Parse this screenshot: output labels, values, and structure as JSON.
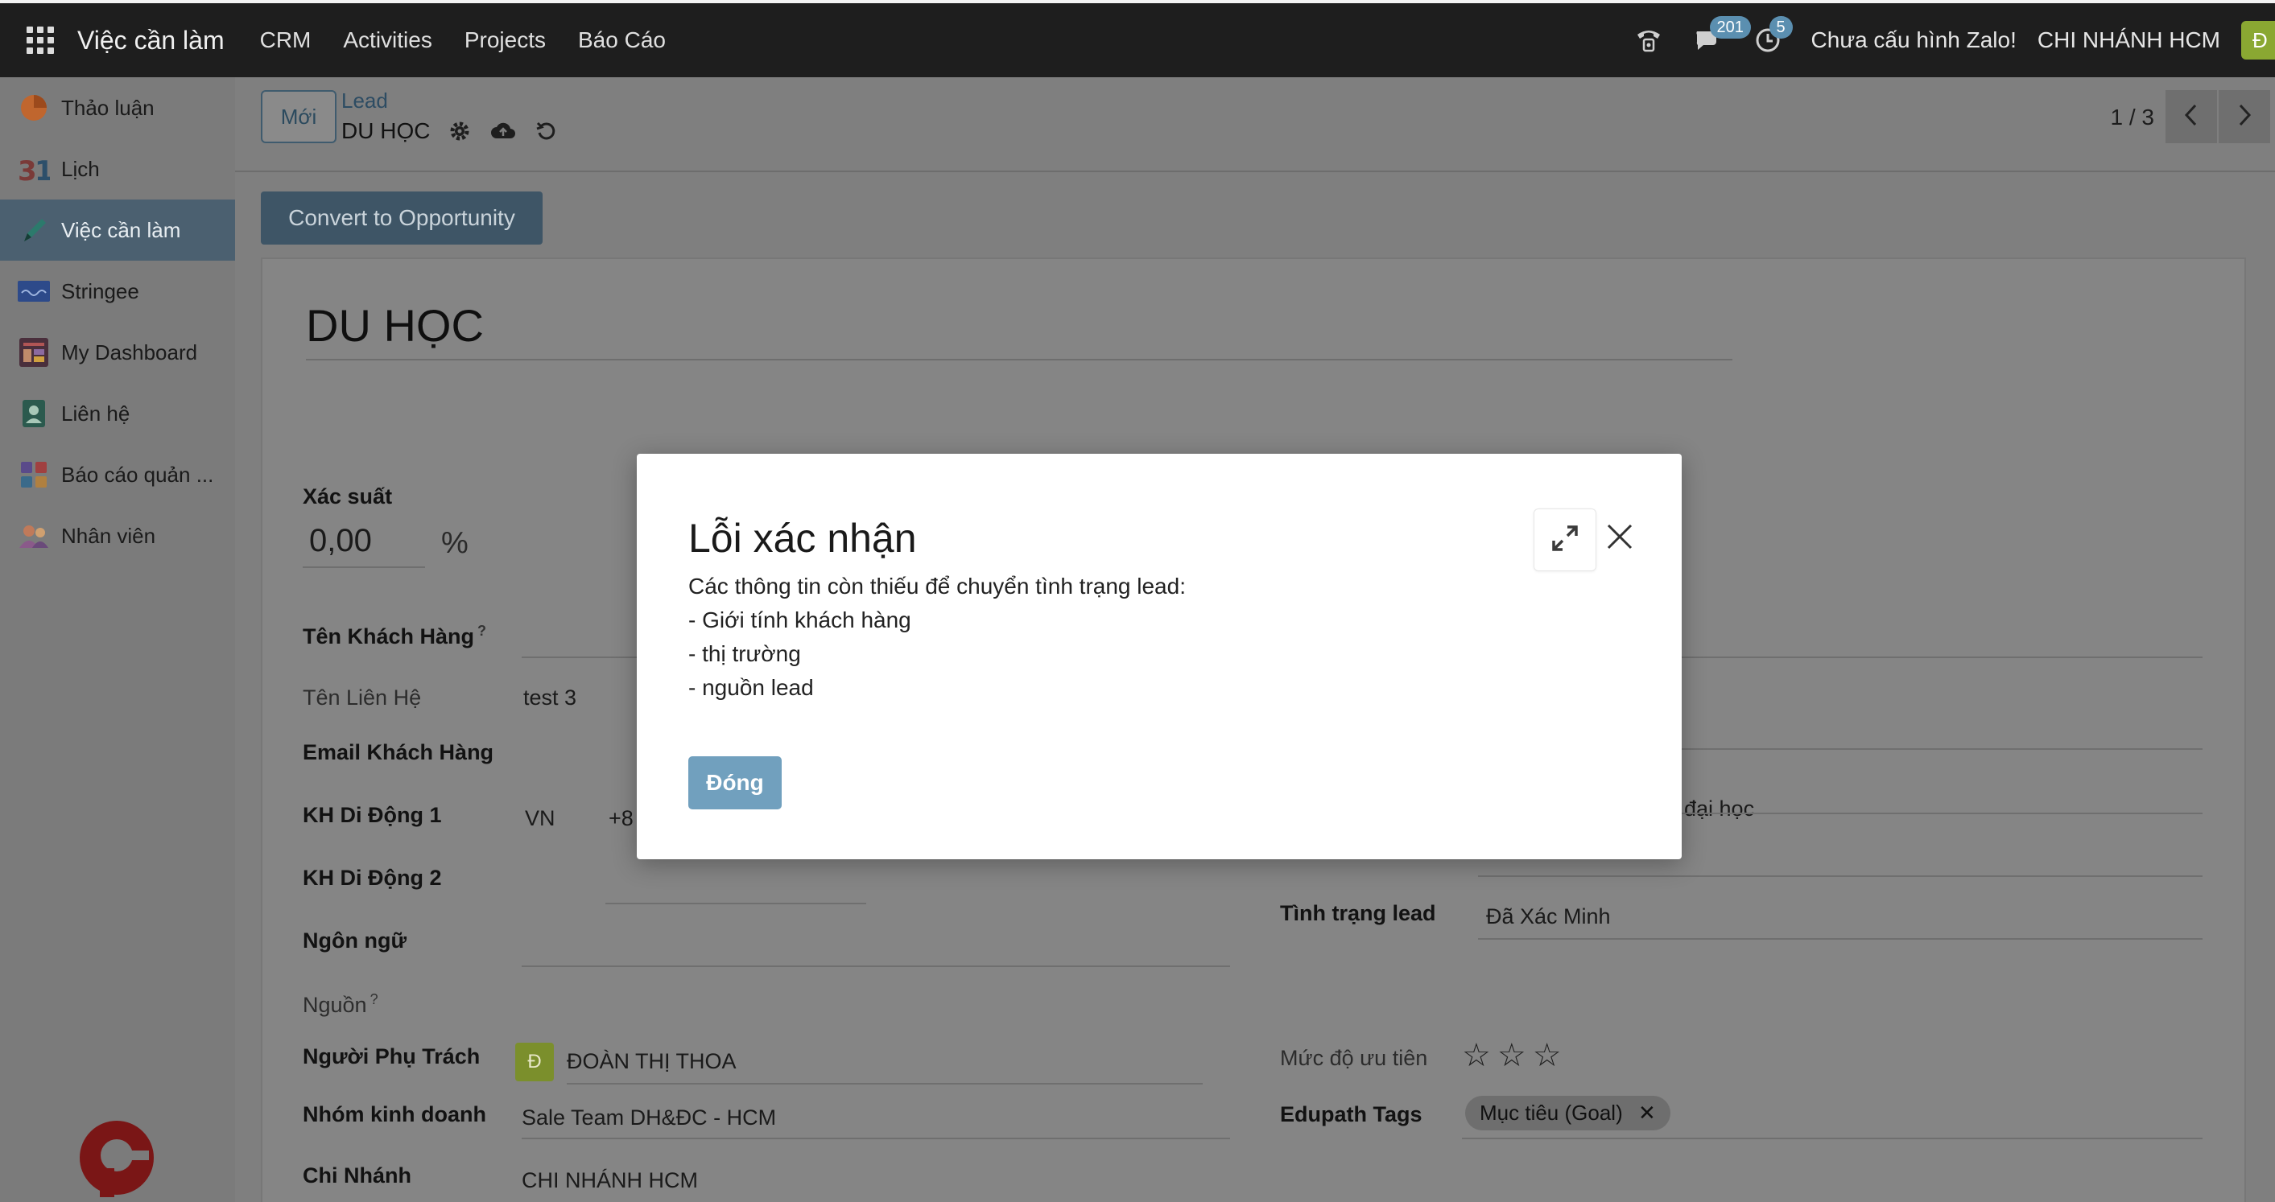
{
  "topbar": {
    "app_name": "Việc cần làm",
    "menu": [
      "CRM",
      "Activities",
      "Projects",
      "Báo Cáo"
    ],
    "messages_count": "201",
    "activities_count": "5",
    "zalo_status": "Chưa cấu hình Zalo!",
    "company": "CHI NHÁNH HCM",
    "user_initial": "Đ"
  },
  "sidebar": {
    "items": [
      {
        "label": "Thảo luận",
        "icon": "discuss-icon"
      },
      {
        "label": "Lịch",
        "icon": "calendar-icon"
      },
      {
        "label": "Việc cần làm",
        "icon": "todo-icon"
      },
      {
        "label": "Stringee",
        "icon": "stringee-icon"
      },
      {
        "label": "My Dashboard",
        "icon": "dashboard-icon"
      },
      {
        "label": "Liên hệ",
        "icon": "contacts-icon"
      },
      {
        "label": "Báo cáo quản ...",
        "icon": "reports-icon"
      },
      {
        "label": "Nhân viên",
        "icon": "employees-icon"
      }
    ],
    "active_index": 2
  },
  "control_panel": {
    "new_button": "Mới",
    "breadcrumb_parent": "Lead",
    "breadcrumb_current": "DU HỌC",
    "pager": "1 / 3",
    "convert_button": "Convert to Opportunity"
  },
  "form": {
    "title": "DU HỌC",
    "probability_label": "Xác suất",
    "probability_value": "0,00",
    "probability_unit": "%",
    "customer_name_label": "Tên Khách Hàng",
    "contact_name_label": "Tên Liên Hệ",
    "contact_name_value": "test 3",
    "email_label": "Email Khách Hàng",
    "mobile1_label": "KH Di Động 1",
    "mobile1_country": "VN",
    "mobile1_prefix": "+8",
    "mobile2_label": "KH Di Động 2",
    "language_label": "Ngôn ngữ",
    "source_label": "Nguồn",
    "salesperson_label": "Người Phụ Trách",
    "salesperson_initial": "Đ",
    "salesperson_value": "ĐOÀN THỊ THOA",
    "sales_team_label": "Nhóm kinh doanh",
    "sales_team_value": "Sale Team DH&ĐC - HCM",
    "branch_label": "Chi Nhánh",
    "branch_value": "CHI NHÁNH HCM",
    "education_value_partial": "đại học",
    "lead_status_label": "Tình trạng lead",
    "lead_status_value": "Đã Xác Minh",
    "priority_label": "Mức độ ưu tiên",
    "priority_value": 0,
    "priority_max": 3,
    "tags_label": "Edupath Tags",
    "tags": [
      "Mục tiêu (Goal)"
    ]
  },
  "modal": {
    "title": "Lỗi xác nhận",
    "message_lines": [
      "Các thông tin còn thiếu để chuyển tình trạng lead:",
      "- Giới tính khách hàng",
      "- thị trường",
      "- nguồn lead"
    ],
    "close_button": "Đóng"
  }
}
